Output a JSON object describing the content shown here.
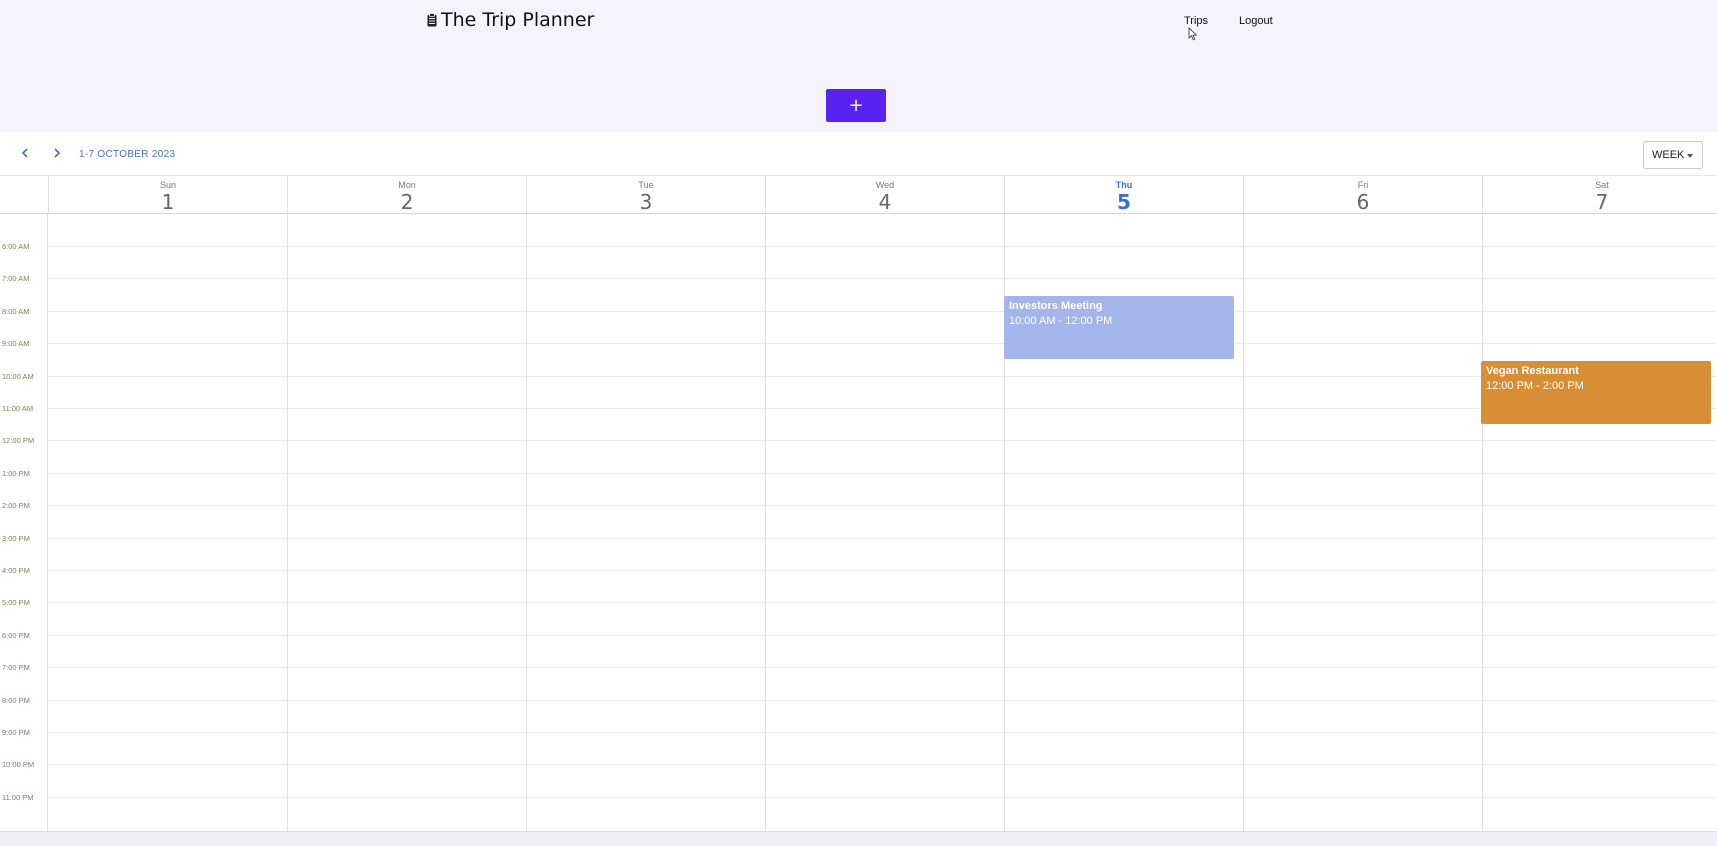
{
  "app": {
    "title": "The Trip Planner",
    "brand_icon": "clipboard-icon"
  },
  "nav": {
    "trips": "Trips",
    "logout": "Logout"
  },
  "add_button": {
    "label": "+"
  },
  "calendar": {
    "range_label": "1-7 OCTOBER 2023",
    "view": "WEEK",
    "days": [
      {
        "name": "Sun",
        "date": "1",
        "today": false
      },
      {
        "name": "Mon",
        "date": "2",
        "today": false
      },
      {
        "name": "Tue",
        "date": "3",
        "today": false
      },
      {
        "name": "Wed",
        "date": "4",
        "today": false
      },
      {
        "name": "Thu",
        "date": "5",
        "today": true
      },
      {
        "name": "Fri",
        "date": "6",
        "today": false
      },
      {
        "name": "Sat",
        "date": "7",
        "today": false
      }
    ],
    "hours": [
      "6:00 AM",
      "7:00 AM",
      "8:00 AM",
      "9:00 AM",
      "10:00 AM",
      "11:00 AM",
      "12:00 PM",
      "1:00 PM",
      "2:00 PM",
      "3:00 PM",
      "4:00 PM",
      "5:00 PM",
      "6:00 PM",
      "7:00 PM",
      "8:00 PM",
      "9:00 PM",
      "10:00 PM",
      "11:00 PM"
    ],
    "events": [
      {
        "title": "Investors Meeting",
        "time": "10:00 AM  -  12:00 PM",
        "day": "Thu",
        "color": "#a3b5ea"
      },
      {
        "title": "Vegan Restaurant",
        "time": "12:00 PM  -  2:00 PM",
        "day": "Sat",
        "color": "#d88e34"
      }
    ]
  },
  "colors": {
    "accent": "#5b23f2",
    "today": "#3f6fc4",
    "background": "#f5f3fd"
  }
}
